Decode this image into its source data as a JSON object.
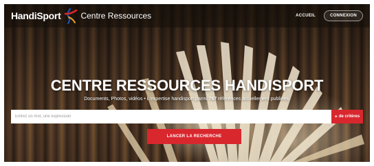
{
  "header": {
    "logo_text": "HandiSport",
    "site_name": "Centre Ressources",
    "nav": {
      "home_label": "ACCUEIL",
      "login_label": "CONNEXION"
    }
  },
  "hero": {
    "title": "CENTRE RESSOURCES HANDISPORT",
    "subtitle_prefix": "Documents, Photos, vidéos • L'expertise handisport parmi ",
    "subtitle_count": "767",
    "subtitle_suffix": " références actuellement publiées."
  },
  "search": {
    "placeholder": "Entrez un mot, une expression",
    "value": "",
    "criteria_label": "de critères",
    "submit_label": "LANCER LA RECHERCHE"
  },
  "colors": {
    "accent": "#d9272e",
    "logo_blue": "#1b4fa0"
  }
}
